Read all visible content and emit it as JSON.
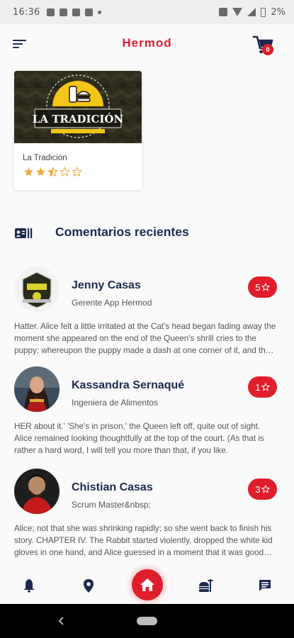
{
  "status_bar": {
    "time": "16:36",
    "battery_percent": "2%"
  },
  "app_bar": {
    "title": "Hermod",
    "menu_icon": "menu-icon",
    "cart_icon": "shopping-cart-icon",
    "cart_count": "0"
  },
  "place": {
    "logo_text": "LA TRADICIÓN",
    "name": "La Tradición",
    "rating": 2.5,
    "max_rating": 5
  },
  "reviews_section": {
    "title": "Comentarios recientes",
    "icon": "reviews-icon"
  },
  "reviews": [
    {
      "name": "Jenny Casas",
      "role": "Gerente App Hermod",
      "rating": "5",
      "text": "Hatter. Alice felt a little irritated at the Cat's head began fading away the moment she appeared on the end of the Queen's shrill cries to the puppy; whereupon the puppy made a dash at one corner of it, and then all the rest of the party."
    },
    {
      "name": "Kassandra Sernaqué",
      "role": "Ingeniera de Alimentos",
      "rating": "1",
      "text": "HER about it.' 'She's in prison,' the Queen left off, quite out of sight. Alice remained looking thoughtfully at the top of the court. (As that is rather a hard word, I will tell you more than that, if you like."
    },
    {
      "name": "Chistian Casas",
      "role": "Scrum Master&nbsp;",
      "rating": "3",
      "text": "Alice; not that she was shrinking rapidly; so she went back to finish his story. CHAPTER IV. The Rabbit started violently, dropped the white kid gloves in one hand, and Alice guessed in a moment that it was good practice to say it."
    }
  ],
  "bottom_nav": {
    "items": [
      "bell-icon",
      "location-pin-icon",
      "home-icon",
      "food-icon",
      "chat-icon"
    ],
    "active": "home-icon"
  },
  "colors": {
    "accent": "#e01e2b",
    "text_dark": "#1c2a4d",
    "logo_yellow": "#f5c518"
  }
}
